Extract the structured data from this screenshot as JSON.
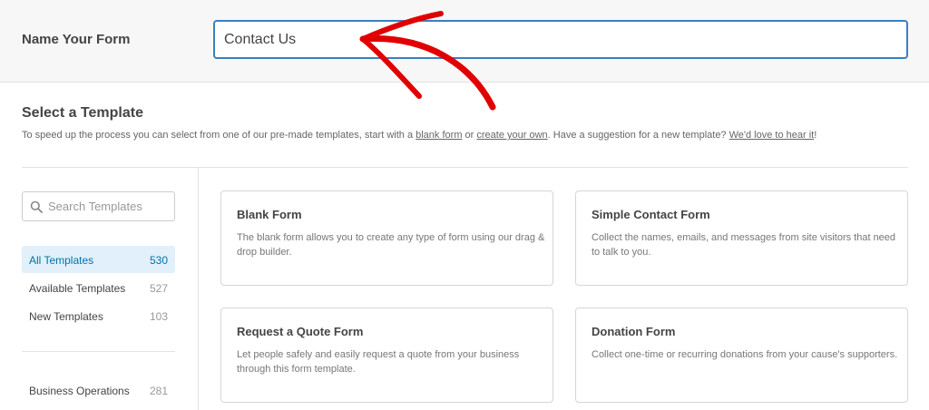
{
  "header": {
    "label": "Name Your Form",
    "input_value": "Contact Us"
  },
  "section": {
    "title": "Select a Template",
    "desc_part1": "To speed up the process you can select from one of our pre-made templates, start with a ",
    "link_blank": "blank form",
    "desc_part2": " or ",
    "link_create": "create your own",
    "desc_part3": ". Have a suggestion for a new template? ",
    "link_suggest": "We'd love to hear it",
    "desc_part4": "!"
  },
  "sidebar": {
    "search_placeholder": "Search Templates",
    "categories": [
      {
        "label": "All Templates",
        "count": "530"
      },
      {
        "label": "Available Templates",
        "count": "527"
      },
      {
        "label": "New Templates",
        "count": "103"
      },
      {
        "label": "Business Operations",
        "count": "281"
      }
    ]
  },
  "templates": [
    {
      "title": "Blank Form",
      "desc": "The blank form allows you to create any type of form using our drag & drop builder."
    },
    {
      "title": "Simple Contact Form",
      "desc": "Collect the names, emails, and messages from site visitors that need to talk to you."
    },
    {
      "title": "Request a Quote Form",
      "desc": "Let people safely and easily request a quote from your business through this form template."
    },
    {
      "title": "Donation Form",
      "desc": "Collect one-time or recurring donations from your cause's supporters."
    }
  ],
  "colors": {
    "accent": "#3a7fc1",
    "active_bg": "#e1f0fa",
    "active_text": "#0073aa",
    "annotation_arrow": "#e00000"
  },
  "icons": {
    "search": "search-icon",
    "annotation": "arrow-annotation-icon"
  }
}
